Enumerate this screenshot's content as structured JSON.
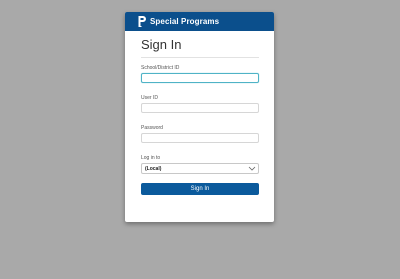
{
  "app": {
    "brand": "Special Programs",
    "logo_icon": "p-logo-icon"
  },
  "form": {
    "title": "Sign In",
    "fields": [
      {
        "label": "School/District ID",
        "value": "",
        "placeholder": ""
      },
      {
        "label": "User ID",
        "value": "",
        "placeholder": ""
      },
      {
        "label": "Password",
        "value": "",
        "placeholder": ""
      }
    ],
    "login_to": {
      "label": "Log in to",
      "selected": "(Local)"
    },
    "submit_label": "Sign In"
  },
  "colors": {
    "background": "#a9a9a9",
    "header": "#0b4f8c",
    "button": "#0b5a9c",
    "focus_border": "#4fb3c6"
  }
}
